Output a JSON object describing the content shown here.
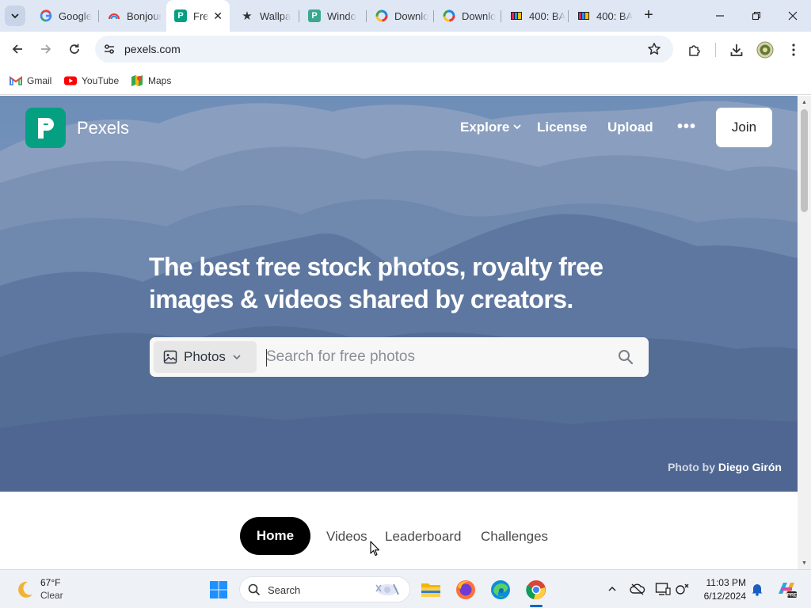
{
  "browser": {
    "tabs": [
      {
        "label": "Google",
        "favicon": "google-icon"
      },
      {
        "label": "Bonjour",
        "favicon": "rainbow-icon"
      },
      {
        "label": "Free",
        "favicon": "pexels-icon",
        "active": true
      },
      {
        "label": "Wallpa",
        "favicon": "star-icon"
      },
      {
        "label": "Windo",
        "favicon": "pexels-icon"
      },
      {
        "label": "Downlo",
        "favicon": "colorwheel-icon"
      },
      {
        "label": "Downlo",
        "favicon": "colorwheel-icon"
      },
      {
        "label": "400: BA",
        "favicon": "video-icon"
      },
      {
        "label": "400: BA",
        "favicon": "video-icon"
      }
    ],
    "new_tab_symbol": "+",
    "address": "pexels.com",
    "bookmarks": [
      {
        "label": "Gmail",
        "icon": "gmail-icon"
      },
      {
        "label": "YouTube",
        "icon": "youtube-icon"
      },
      {
        "label": "Maps",
        "icon": "maps-icon"
      }
    ]
  },
  "page": {
    "brand": "Pexels",
    "nav": {
      "explore": "Explore",
      "license": "License",
      "upload": "Upload",
      "more": "•••",
      "join": "Join"
    },
    "headline": "The best free stock photos, royalty free images & videos shared by creators.",
    "search": {
      "type_label": "Photos",
      "placeholder": "Search for free photos"
    },
    "credit": {
      "prefix": "Photo by",
      "author": "Diego Girón"
    },
    "subnav": {
      "home": "Home",
      "videos": "Videos",
      "leaderboard": "Leaderboard",
      "challenges": "Challenges"
    },
    "colors": {
      "brand": "#05a081",
      "hero_base": "#6e86ab",
      "home_pill": "#000000"
    }
  },
  "taskbar": {
    "weather": {
      "temp": "67°F",
      "condition": "Clear"
    },
    "search_label": "Search",
    "apps": [
      "file-explorer-icon",
      "firefox-icon",
      "edge-icon",
      "chrome-icon"
    ],
    "clock": {
      "time": "11:03 PM",
      "date": "6/12/2024"
    }
  }
}
